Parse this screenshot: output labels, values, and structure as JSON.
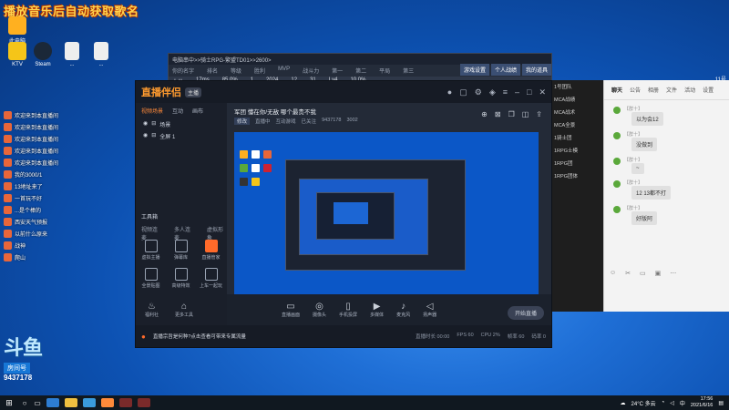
{
  "overlay_title": "播放音乐后自动获取歌名",
  "desktop_icons": [
    {
      "label": "此电脑",
      "color": "#ffb020"
    },
    {
      "label": "KTV",
      "color": "#f5c518"
    },
    {
      "label": "Steam",
      "color": "#1b2838"
    },
    {
      "label": "...",
      "color": "#eeeeee"
    },
    {
      "label": "...",
      "color": "#eeeeee"
    }
  ],
  "chat_lines": [
    "欢迎来到本直播间",
    "欢迎来到本直播间",
    "欢迎来到本直播间",
    "欢迎来到本直播间",
    "欢迎来到本直播间",
    "我的3000/1",
    "13地址来了",
    "一首玩不好",
    "...是个棒的",
    "西安天气预报",
    "以前什么原来",
    "战神",
    "爬山"
  ],
  "back_window": {
    "title": "电脑串中>>骑士RPG-繁盟TD01>>2600>",
    "columns": [
      "你的名字",
      "排名",
      "等级",
      "胜利",
      "MVP",
      "战斗力",
      "第一",
      "第二",
      "平局",
      "第三"
    ],
    "row": [
      "人类",
      "17ms",
      "85.0%",
      "1",
      "2024",
      "12",
      "31",
      "Lv4",
      "10.0%"
    ]
  },
  "right_tabs": [
    "游戏设置",
    "个人战绩",
    "我的道具"
  ],
  "app": {
    "logo": "直播伴侣",
    "badge": "主播",
    "side_tabs": [
      "视频场景",
      "互动",
      "画布"
    ],
    "scenes": [
      "场景",
      "全屏 1"
    ],
    "tools_head": "工具箱",
    "tools_sub": [
      "视频连麦",
      "多人连麦",
      "虚拟形象"
    ],
    "tools": [
      {
        "label": "虚拟主播",
        "hot": false
      },
      {
        "label": "弹幕库",
        "hot": false
      },
      {
        "label": "直播管家",
        "hot": true
      },
      {
        "label": "全景贴图",
        "hot": false
      },
      {
        "label": "高级特效",
        "hot": false
      },
      {
        "label": "上车一起玩",
        "hot": false
      }
    ],
    "bottom_left": [
      "福利社",
      "更多工具"
    ],
    "room_title": "军团 懂在你/无敌 哪个最贵不我",
    "room_tag": "修改",
    "room_info": [
      "直播中",
      "互动游戏",
      "已关注",
      "9437178",
      "3002"
    ],
    "bottom_items": [
      "直播画面",
      "摄像头",
      "手机投屏",
      "多媒体",
      "麦克风",
      "扬声器"
    ],
    "start_button": "开始直播",
    "warning": "直播宗旨是何种?点击查看可带来专属流量",
    "stats": [
      "直播时长 00:00",
      "FPS 60",
      "CPU 2%",
      "帧率 60",
      "码率 0"
    ]
  },
  "chat_window": {
    "header": "11号",
    "tabs": [
      "聊天",
      "公告",
      "相册",
      "文件",
      "活动",
      "设置"
    ],
    "messages": [
      {
        "who": "【群十】",
        "text": "以为会12"
      },
      {
        "who": "【群十】",
        "text": "没做到"
      },
      {
        "who": "【群十】",
        "text": "~"
      },
      {
        "who": "【群十】",
        "text": "12 13都不打"
      },
      {
        "who": "【群十】",
        "text": "好版阿"
      }
    ]
  },
  "mid_list": [
    "1号团队",
    "MCA战绩",
    "MCA战术",
    "MCA全景",
    "1骑士团",
    "1RPG士模",
    "1RPG团",
    "1RPG团体"
  ],
  "taskbar": {
    "temperature": "24°C 多云",
    "lang": "中",
    "time": "17:56",
    "date": "2021/6/16"
  },
  "streamer_badge": {
    "brand": "斗鱼",
    "room_label": "房间号",
    "room_id": "9437178"
  }
}
